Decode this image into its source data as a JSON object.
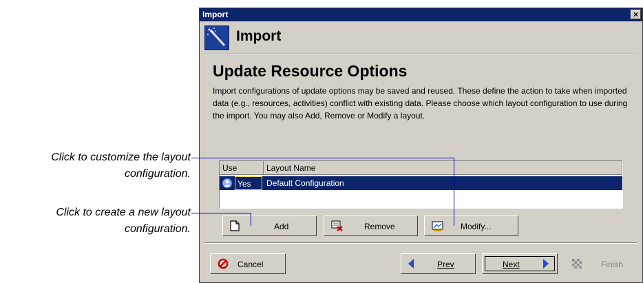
{
  "callouts": {
    "modify": [
      "Click to customize the layout",
      "configuration."
    ],
    "add": [
      "Click to create a new layout",
      "configuration."
    ]
  },
  "window": {
    "title": "Import",
    "close_glyph": "×"
  },
  "header": {
    "title": "Import",
    "icon": "magic-wand-icon"
  },
  "page": {
    "title": "Update Resource Options",
    "description": "Import configurations of update options may be saved and reused.  These define the action to take when imported data (e.g., resources, activities) conflict with existing data.  Please choose which layout configuration to use during the import. You may also Add, Remove or Modify a layout."
  },
  "table": {
    "columns": [
      "Use",
      "Layout Name"
    ],
    "rows": [
      {
        "use": "Yes",
        "name": "Default Configuration",
        "selected": true
      }
    ]
  },
  "buttons": {
    "add": "Add",
    "remove": "Remove",
    "modify": "Modify...",
    "cancel": "Cancel",
    "prev": "Prev",
    "next": "Next",
    "finish": "Finish"
  },
  "colors": {
    "title_bar": "#0b246a",
    "selection": "#0b246a",
    "callout_line": "#0000cc"
  }
}
